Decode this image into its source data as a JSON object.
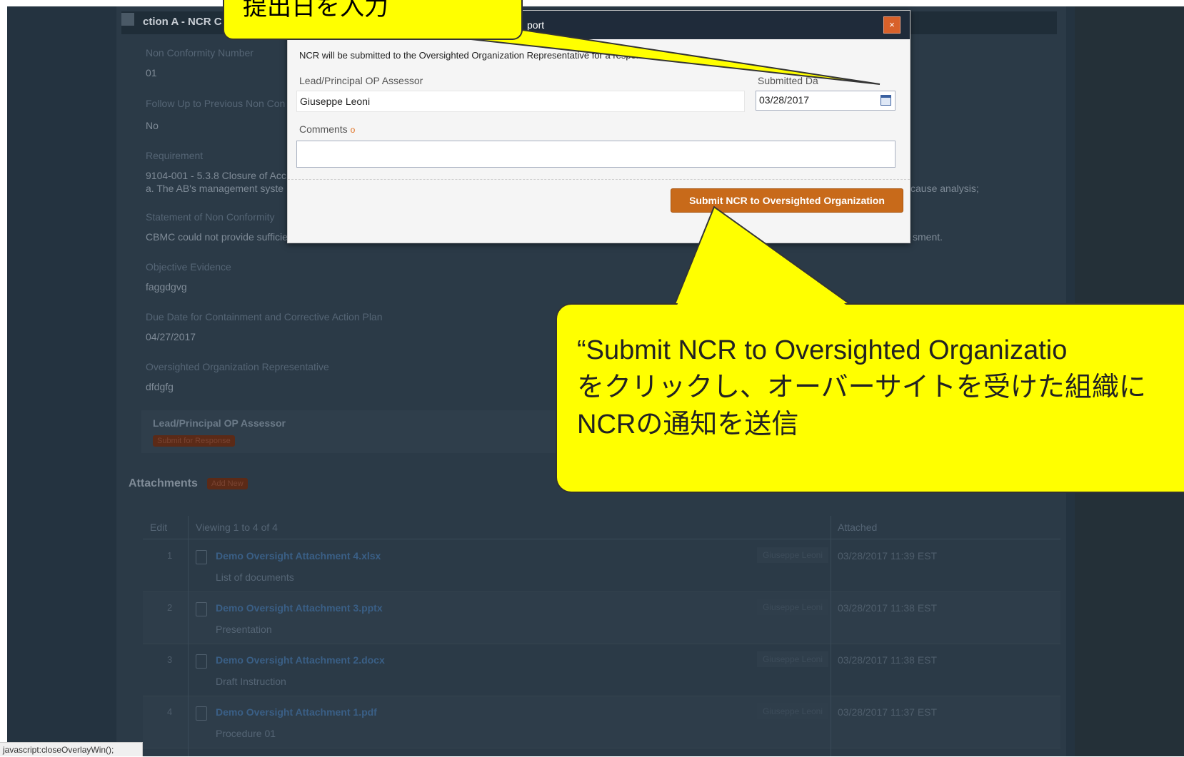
{
  "page": {
    "section_title": "ction A - NCR C",
    "fields": [
      {
        "label": "Non Conformity Number",
        "value": "01"
      },
      {
        "label": "Follow Up to Previous Non Con",
        "value": "No"
      },
      {
        "label": "Requirement",
        "value": "9104-001 - 5.3.8 Closure of Acc",
        "value2": "a. The AB's management syste",
        "value_right": "cause analysis;"
      },
      {
        "label": "Statement of Non Conformity",
        "value": "CBMC could not provide sufficie",
        "value_right": "sment."
      },
      {
        "label": "Objective Evidence",
        "value": "faggdgvg"
      },
      {
        "label": "Due Date for Containment and Corrective Action Plan",
        "value": "04/27/2017"
      },
      {
        "label": "Oversighted Organization Representative",
        "value": "dfdgfg"
      }
    ],
    "lead_box": {
      "label": "Lead/Principal OP Assessor",
      "button": "Submit for Response"
    },
    "attachments": {
      "title": "Attachments",
      "add_button": "Add New",
      "headers": {
        "edit": "Edit",
        "viewing": "Viewing 1 to 4 of 4",
        "attached": "Attached"
      },
      "rows": [
        {
          "num": "1",
          "name": "Demo Oversight Attachment 4.xlsx",
          "desc": "List of documents",
          "author": "Giuseppe Leoni",
          "date": "03/28/2017 11:39 EST"
        },
        {
          "num": "2",
          "name": "Demo Oversight Attachment 3.pptx",
          "desc": "Presentation",
          "author": "Giuseppe Leoni",
          "date": "03/28/2017 11:38 EST"
        },
        {
          "num": "3",
          "name": "Demo Oversight Attachment 2.docx",
          "desc": "Draft Instruction",
          "author": "Giuseppe Leoni",
          "date": "03/28/2017 11:38 EST"
        },
        {
          "num": "4",
          "name": "Demo Oversight Attachment 1.pdf",
          "desc": "Procedure 01",
          "author": "Giuseppe Leoni",
          "date": "03/28/2017 11:37 EST"
        }
      ]
    }
  },
  "modal": {
    "title_fragment": "port",
    "close_label": "×",
    "info_text": "NCR will be submitted to the Oversighted Organization Representative for a response.",
    "assessor_label": "Lead/Principal OP Assessor",
    "assessor_value": "Giuseppe Leoni",
    "submitted_label": "Submitted Da",
    "submitted_value": "03/28/2017",
    "comments_label": "Comments",
    "comments_value": "",
    "submit_button": "Submit NCR to Oversighted Organization"
  },
  "callouts": {
    "top_text": "提出日を入力",
    "bottom_lines": [
      "“Submit NCR to Oversighted Organizatio",
      "をクリックし、オーバーサイトを受けた組織に",
      "NCRの通知を送信"
    ]
  },
  "statusbar": {
    "text": "javascript:closeOverlayWin();"
  },
  "colors": {
    "accent": "#c86a1a",
    "callout": "#ffff00",
    "modal_header": "#1f2b3a"
  }
}
